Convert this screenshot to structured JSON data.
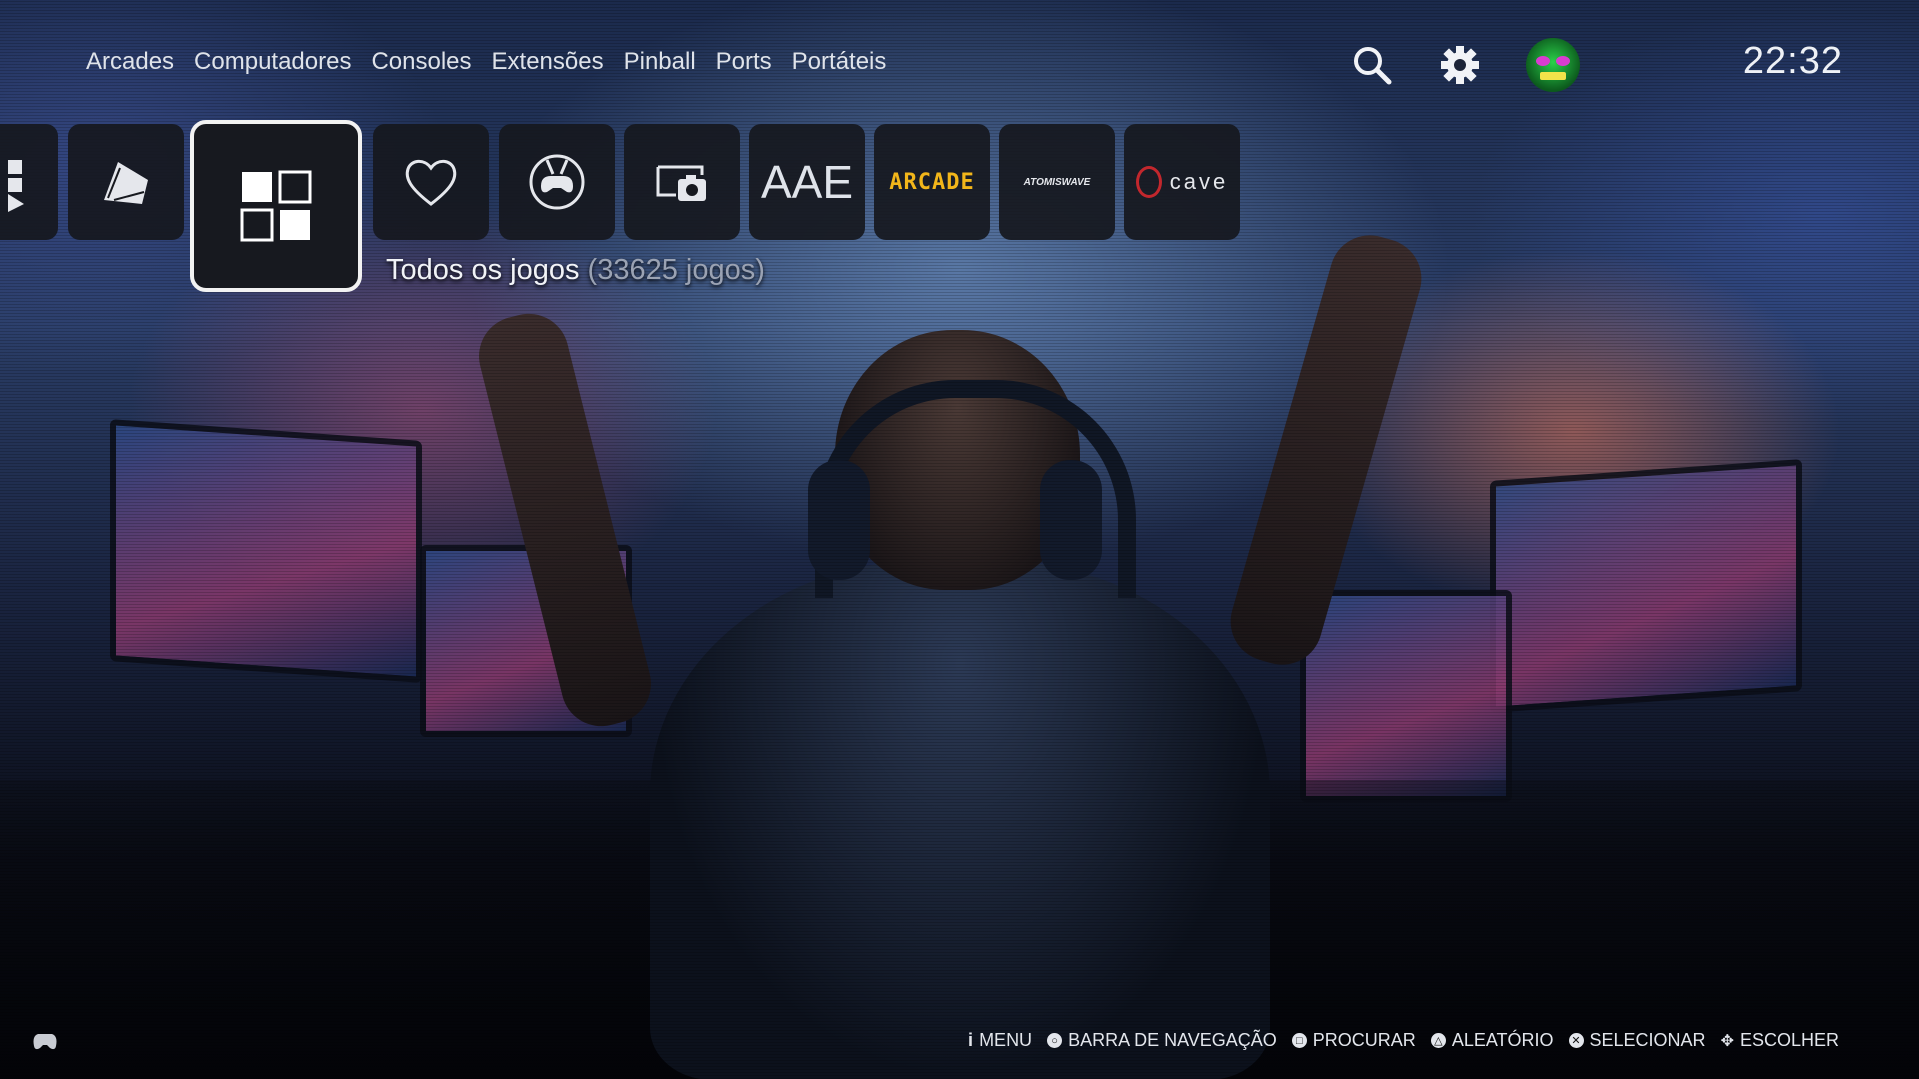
{
  "topnav": {
    "items": [
      {
        "label": "Arcades"
      },
      {
        "label": "Computadores"
      },
      {
        "label": "Consoles"
      },
      {
        "label": "Extensões"
      },
      {
        "label": "Pinball"
      },
      {
        "label": "Ports"
      },
      {
        "label": "Portáteis"
      }
    ]
  },
  "header_icons": {
    "search": "search-icon",
    "settings": "gear-icon",
    "profile": "profile-avatar"
  },
  "clock": "22:32",
  "shelf": {
    "tiles": [
      {
        "icon": "collections-icon"
      },
      {
        "icon": "book-icon"
      },
      {
        "icon": "all-games-grid-icon",
        "selected": true
      },
      {
        "icon": "heart-icon"
      },
      {
        "icon": "multiplayer-gamepad-icon"
      },
      {
        "icon": "screenshot-camera-icon"
      },
      {
        "text": "AAE"
      },
      {
        "text": "ARCADE"
      },
      {
        "text": "ATOMISWAVE"
      },
      {
        "text": "cave"
      }
    ],
    "selected_title": "Todos os jogos",
    "selected_count": "(33625 jogos)"
  },
  "bottom_hints": [
    {
      "icon": "info-icon",
      "label": "MENU"
    },
    {
      "icon": "button-circle-icon",
      "label": "BARRA DE NAVEGAÇÃO"
    },
    {
      "icon": "button-square-icon",
      "label": "PROCURAR"
    },
    {
      "icon": "button-triangle-icon",
      "label": "ALEATÓRIO"
    },
    {
      "icon": "button-cross-icon",
      "label": "SELECIONAR"
    },
    {
      "icon": "dpad-icon",
      "label": "ESCOLHER"
    }
  ],
  "colors": {
    "selected_border": "#f2f2f2",
    "tile_bg": "#16181e",
    "count_text": "#9aa2b3"
  }
}
